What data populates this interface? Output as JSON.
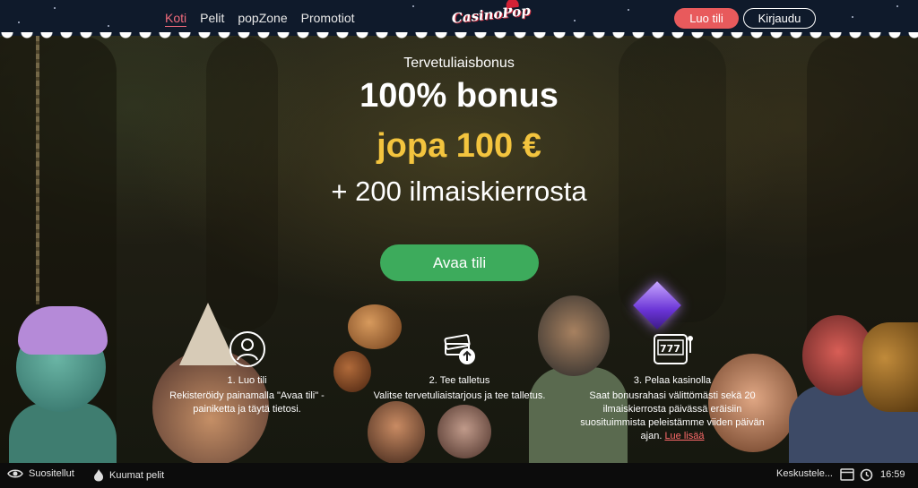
{
  "nav": {
    "links": [
      "Koti",
      "Pelit",
      "popZone",
      "Promotiot"
    ],
    "active_index": 0,
    "logo_text": "CasinoPop",
    "register_label": "Luo tili",
    "login_label": "Kirjaudu"
  },
  "hero": {
    "welcome": "Tervetuliaisbonus",
    "bonus": "100% bonus",
    "amount": "jopa 100 €",
    "spins": "+ 200 ilmaiskierrosta",
    "cta_label": "Avaa tili"
  },
  "steps": [
    {
      "icon": "user-icon",
      "title": "1. Luo tili",
      "text": "Rekisteröidy painamalla \"Avaa tili\" -painiketta ja täytä tietosi."
    },
    {
      "icon": "money-upload-icon",
      "title": "2. Tee talletus",
      "text": "Valitse tervetuliaistarjous ja tee talletus."
    },
    {
      "icon": "slot-machine-icon",
      "title": "3. Pelaa kasinolla",
      "text": "Saat bonusrahasi välittömästi sekä 20 ilmaiskierrosta päivässä eräisiin suosituimmista peleistämme viiden päivän ajan.",
      "link": "Lue lisää"
    }
  ],
  "bottombar": {
    "recommended": "Suositellut",
    "hot": "Kuumat pelit",
    "chat": "Keskustele...",
    "time": "16:59"
  },
  "colors": {
    "accent_red": "#e85a5c",
    "cta_green": "#3dab5c",
    "gold": "#f3c43e",
    "nav_bg": "#0f1a2b"
  }
}
